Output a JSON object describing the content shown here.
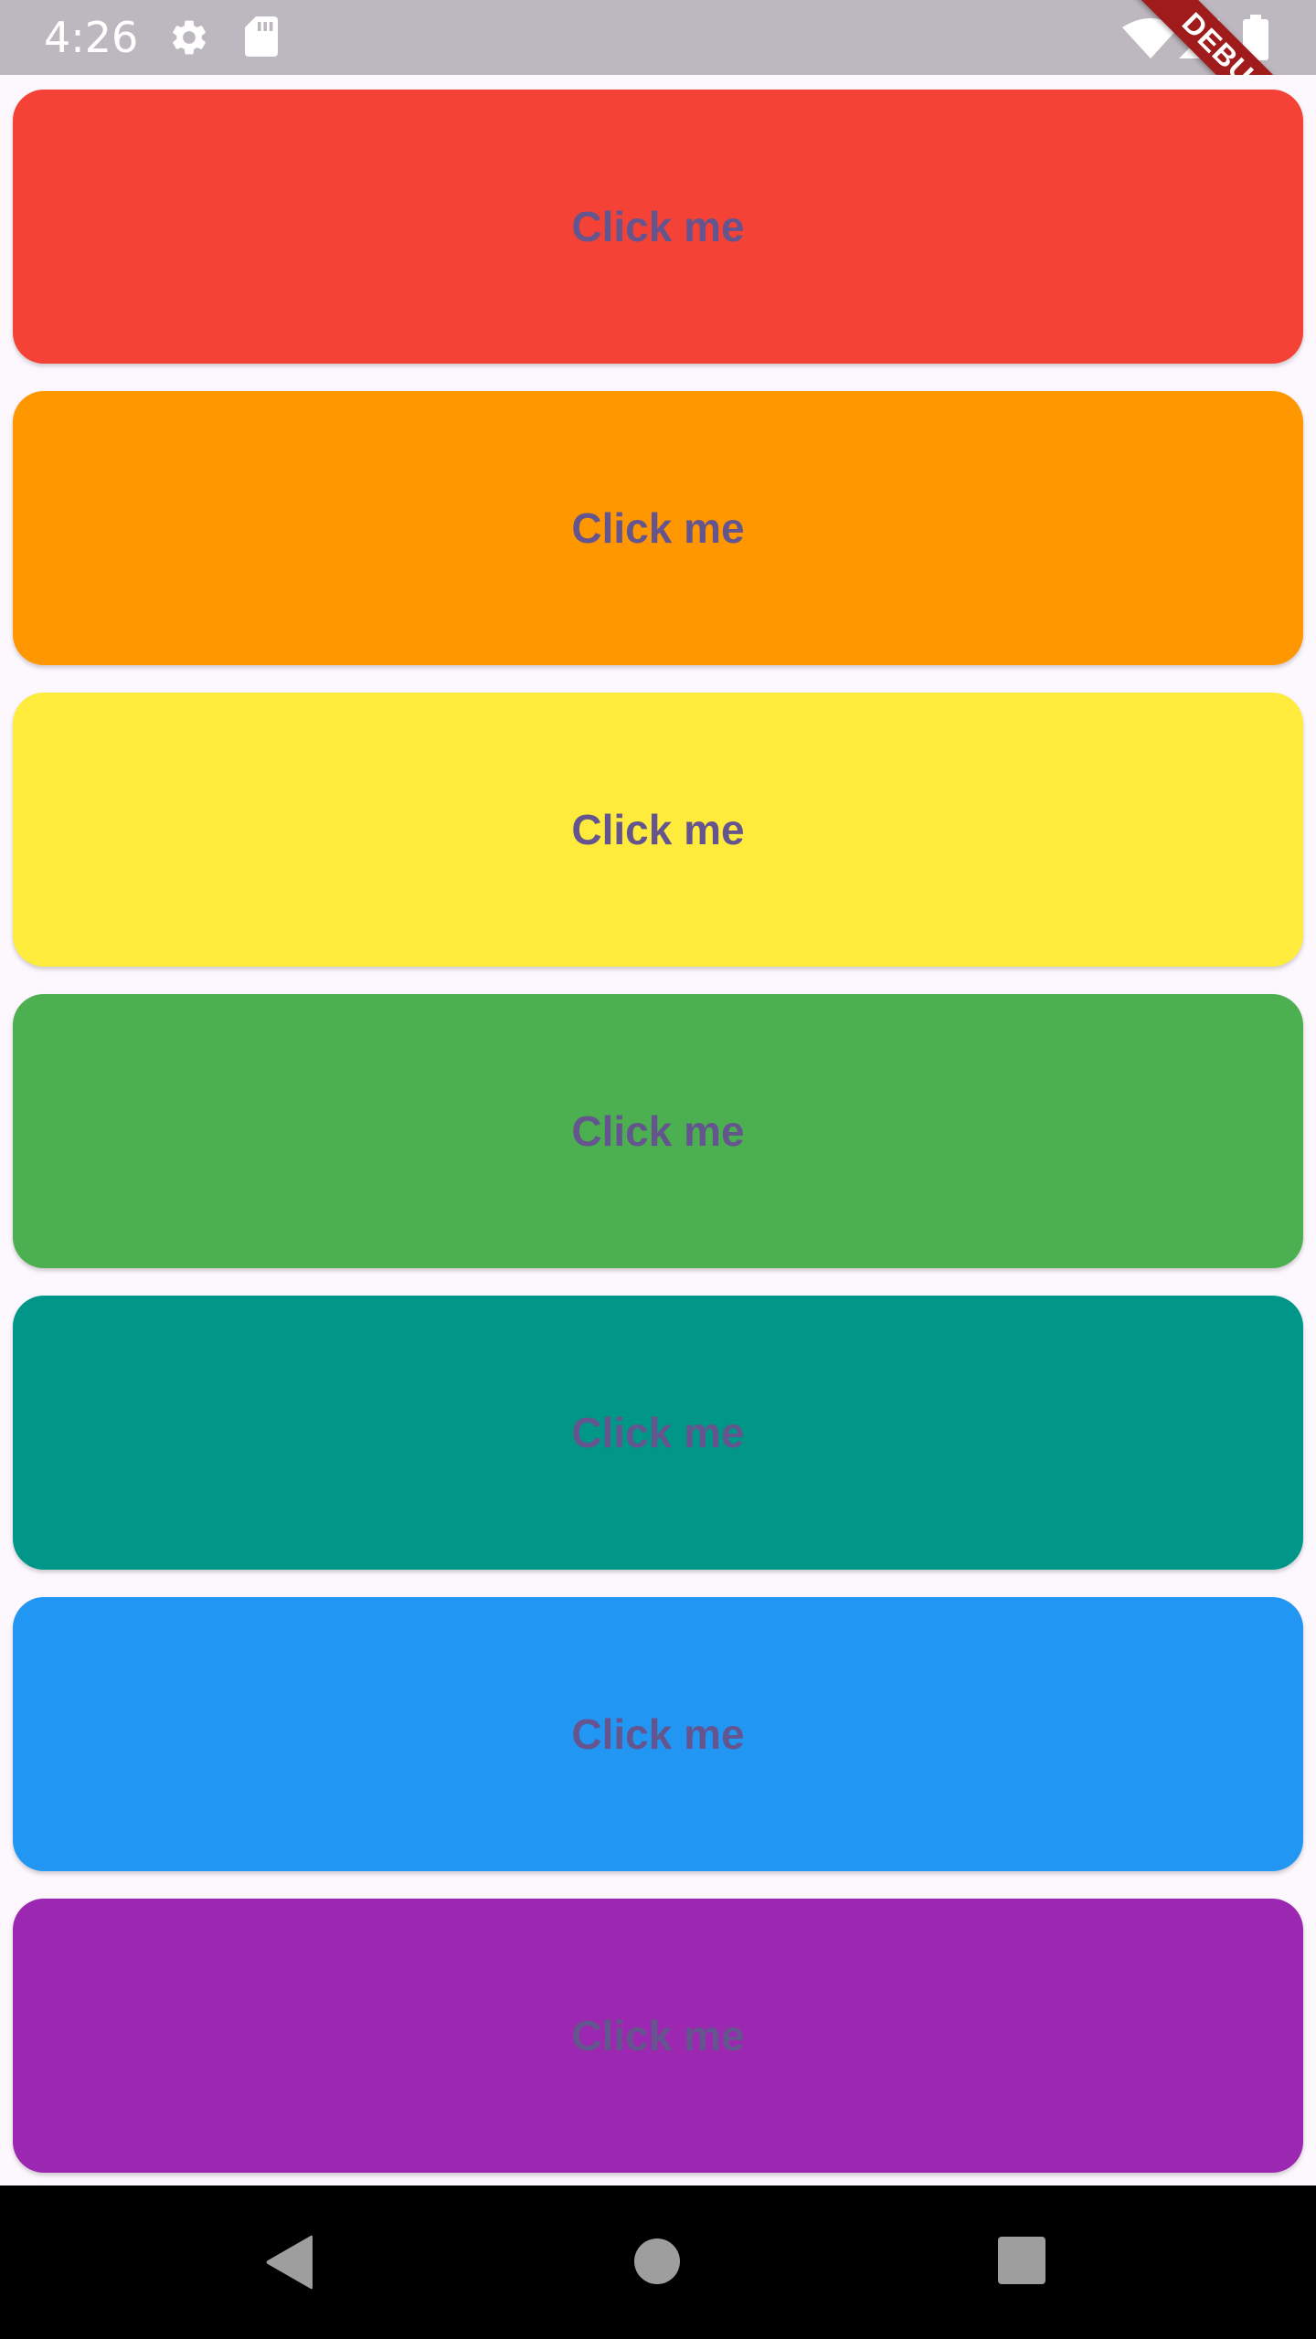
{
  "status_bar": {
    "time": "4:26",
    "icons": [
      "gear-icon",
      "sd-card-icon",
      "wifi-icon",
      "cell-signal-icon",
      "battery-icon"
    ]
  },
  "debug_banner": {
    "label": "DEBUG",
    "color": "#a01c1c"
  },
  "buttons": [
    {
      "label": "Click me",
      "color": "#f44336"
    },
    {
      "label": "Click me",
      "color": "#ff9800"
    },
    {
      "label": "Click me",
      "color": "#ffeb3b"
    },
    {
      "label": "Click me",
      "color": "#4caf50"
    },
    {
      "label": "Click me",
      "color": "#009688"
    },
    {
      "label": "Click me",
      "color": "#2196f3"
    },
    {
      "label": "Click me",
      "color": "#9c27b0"
    }
  ],
  "theme": {
    "label_color": "#65558f",
    "background": "#fdf7fe"
  },
  "nav_bar": {
    "icons": [
      "back-icon",
      "home-icon",
      "recents-icon"
    ]
  }
}
